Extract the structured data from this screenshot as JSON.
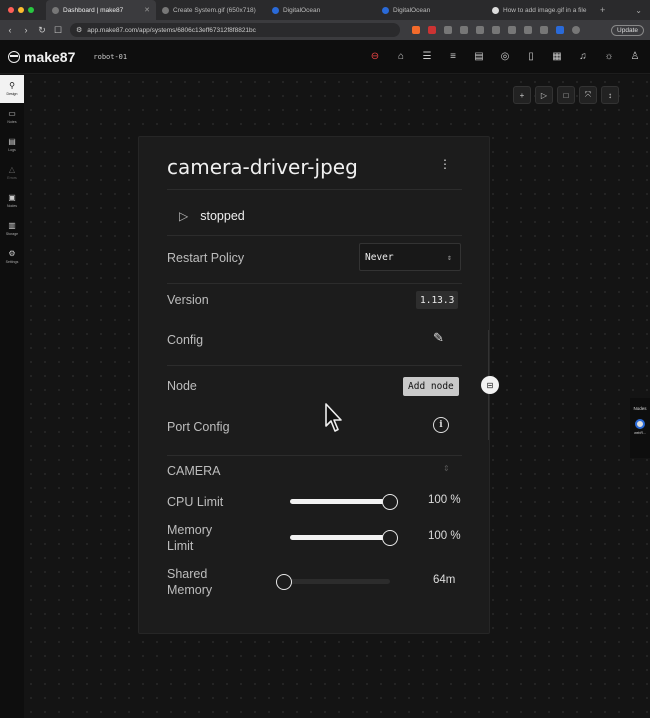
{
  "browser": {
    "tabs": [
      {
        "label": "Dashboard | make87",
        "active": true
      },
      {
        "label": "Create System.gif (650x718)",
        "active": false
      },
      {
        "label": "DigitalOcean",
        "active": false
      },
      {
        "label": "DigitalOcean",
        "active": false
      },
      {
        "label": "How to add image.gif in a file",
        "active": false
      }
    ],
    "url": "app.make87.com/app/systems/6806c13eff67312f8f8821bc",
    "update_label": "Update"
  },
  "header": {
    "logo_text": "make87",
    "robot_name": "robot-01"
  },
  "sidebar": {
    "items": [
      {
        "label": "Design",
        "icon": "design-icon"
      },
      {
        "label": "Notes",
        "icon": "notes-icon"
      },
      {
        "label": "Logs",
        "icon": "logs-icon"
      },
      {
        "label": "Errors",
        "icon": "errors-icon"
      },
      {
        "label": "Nodes",
        "icon": "nodes-icon"
      },
      {
        "label": "Storage",
        "icon": "storage-icon"
      },
      {
        "label": "Settings",
        "icon": "settings-icon"
      }
    ]
  },
  "panel": {
    "title": "camera-driver-jpeg",
    "status": "stopped",
    "restart_policy_label": "Restart Policy",
    "restart_policy_value": "Never",
    "version_label": "Version",
    "version_value": "1.13.3",
    "config_label": "Config",
    "node_label": "Node",
    "add_node_label": "Add node",
    "port_config_label": "Port Config",
    "camera_label": "CAMERA",
    "cpu_limit_label": "CPU Limit",
    "cpu_limit_value": "100 %",
    "cpu_limit_fraction": 1.0,
    "memory_limit_label_1": "Memory",
    "memory_limit_label_2": "Limit",
    "memory_limit_value": "100 %",
    "memory_limit_fraction": 1.0,
    "shared_memory_label_1": "Shared",
    "shared_memory_label_2": "Memory",
    "shared_memory_value": "64m",
    "shared_memory_fraction": 0.0
  },
  "right_sidebar": {
    "title": "Nodes",
    "item_label": "webR..."
  },
  "colors": {
    "background": "#141414",
    "panel": "#1c1c1c",
    "accent": "#f2f2f2",
    "ros_red": "#e44444"
  }
}
